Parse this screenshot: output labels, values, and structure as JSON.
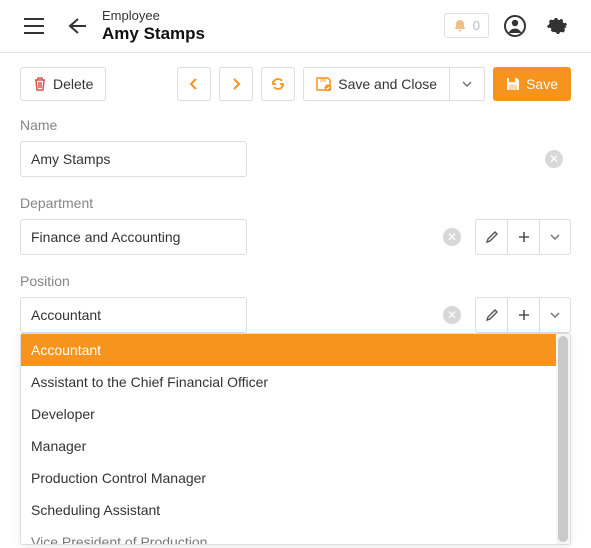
{
  "header": {
    "subtitle": "Employee",
    "title": "Amy Stamps",
    "notif_count": "0"
  },
  "toolbar": {
    "delete_label": "Delete",
    "save_close_label": "Save and Close",
    "save_label": "Save"
  },
  "fields": {
    "name": {
      "label": "Name",
      "value": "Amy Stamps"
    },
    "department": {
      "label": "Department",
      "value": "Finance and Accounting"
    },
    "position": {
      "label": "Position",
      "value": "Accountant"
    }
  },
  "position_dropdown": {
    "items": [
      "Accountant",
      "Assistant to the Chief Financial Officer",
      "Developer",
      "Manager",
      "Production Control Manager",
      "Scheduling Assistant",
      "Vice President of Production"
    ],
    "selected_index": 0
  }
}
